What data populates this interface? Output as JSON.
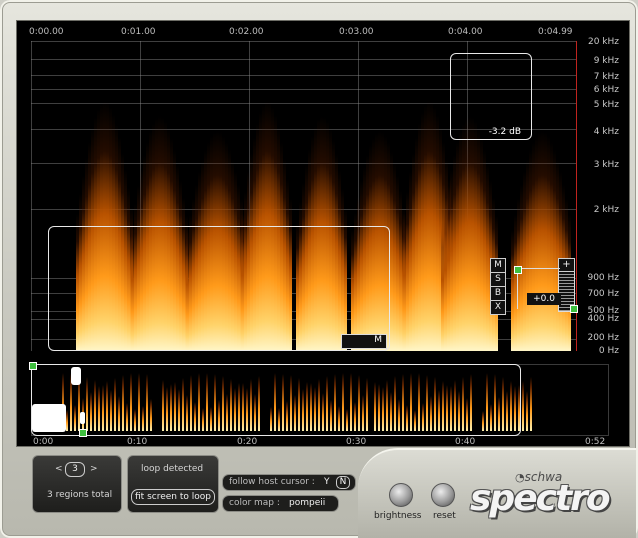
{
  "time_ticks": [
    "0:00.00",
    "0:01.00",
    "0:02.00",
    "0:03.00",
    "0:04.00",
    "0:04.99"
  ],
  "freq_ticks": [
    "20 kHz",
    "9 kHz",
    "7 kHz",
    "6 kHz",
    "5 kHz",
    "4 kHz",
    "3 kHz",
    "2 kHz",
    "900 Hz",
    "700 Hz",
    "500 Hz",
    "400 Hz",
    "200 Hz",
    "0 Hz"
  ],
  "db_readout": "-3.2 dB",
  "gain_readout": "+0.0",
  "marker_label": "M",
  "msbx": [
    "M",
    "S",
    "B",
    "X"
  ],
  "plus_label": "+",
  "overview_ticks": [
    "0:00",
    "0:10",
    "0:20",
    "0:30",
    "0:40",
    "0:52"
  ],
  "regions": {
    "prev": "<",
    "count": "3",
    "next": ">",
    "total_label": "3 regions total"
  },
  "loop": {
    "status": "loop detected",
    "fit_button": "fit screen to loop"
  },
  "follow": {
    "label": "follow host cursor :",
    "yes": "Y",
    "no": "N"
  },
  "colormap": {
    "label": "color map :",
    "value": "pompeii"
  },
  "knobs": {
    "brightness": "brightness",
    "reset": "reset"
  },
  "brand": {
    "company": "schwa",
    "product": "spectro"
  },
  "colors": {
    "accent": "#ff9a1a",
    "hot": "#ffe8a0",
    "background": "#000000",
    "panel": "#c9c9c0"
  }
}
